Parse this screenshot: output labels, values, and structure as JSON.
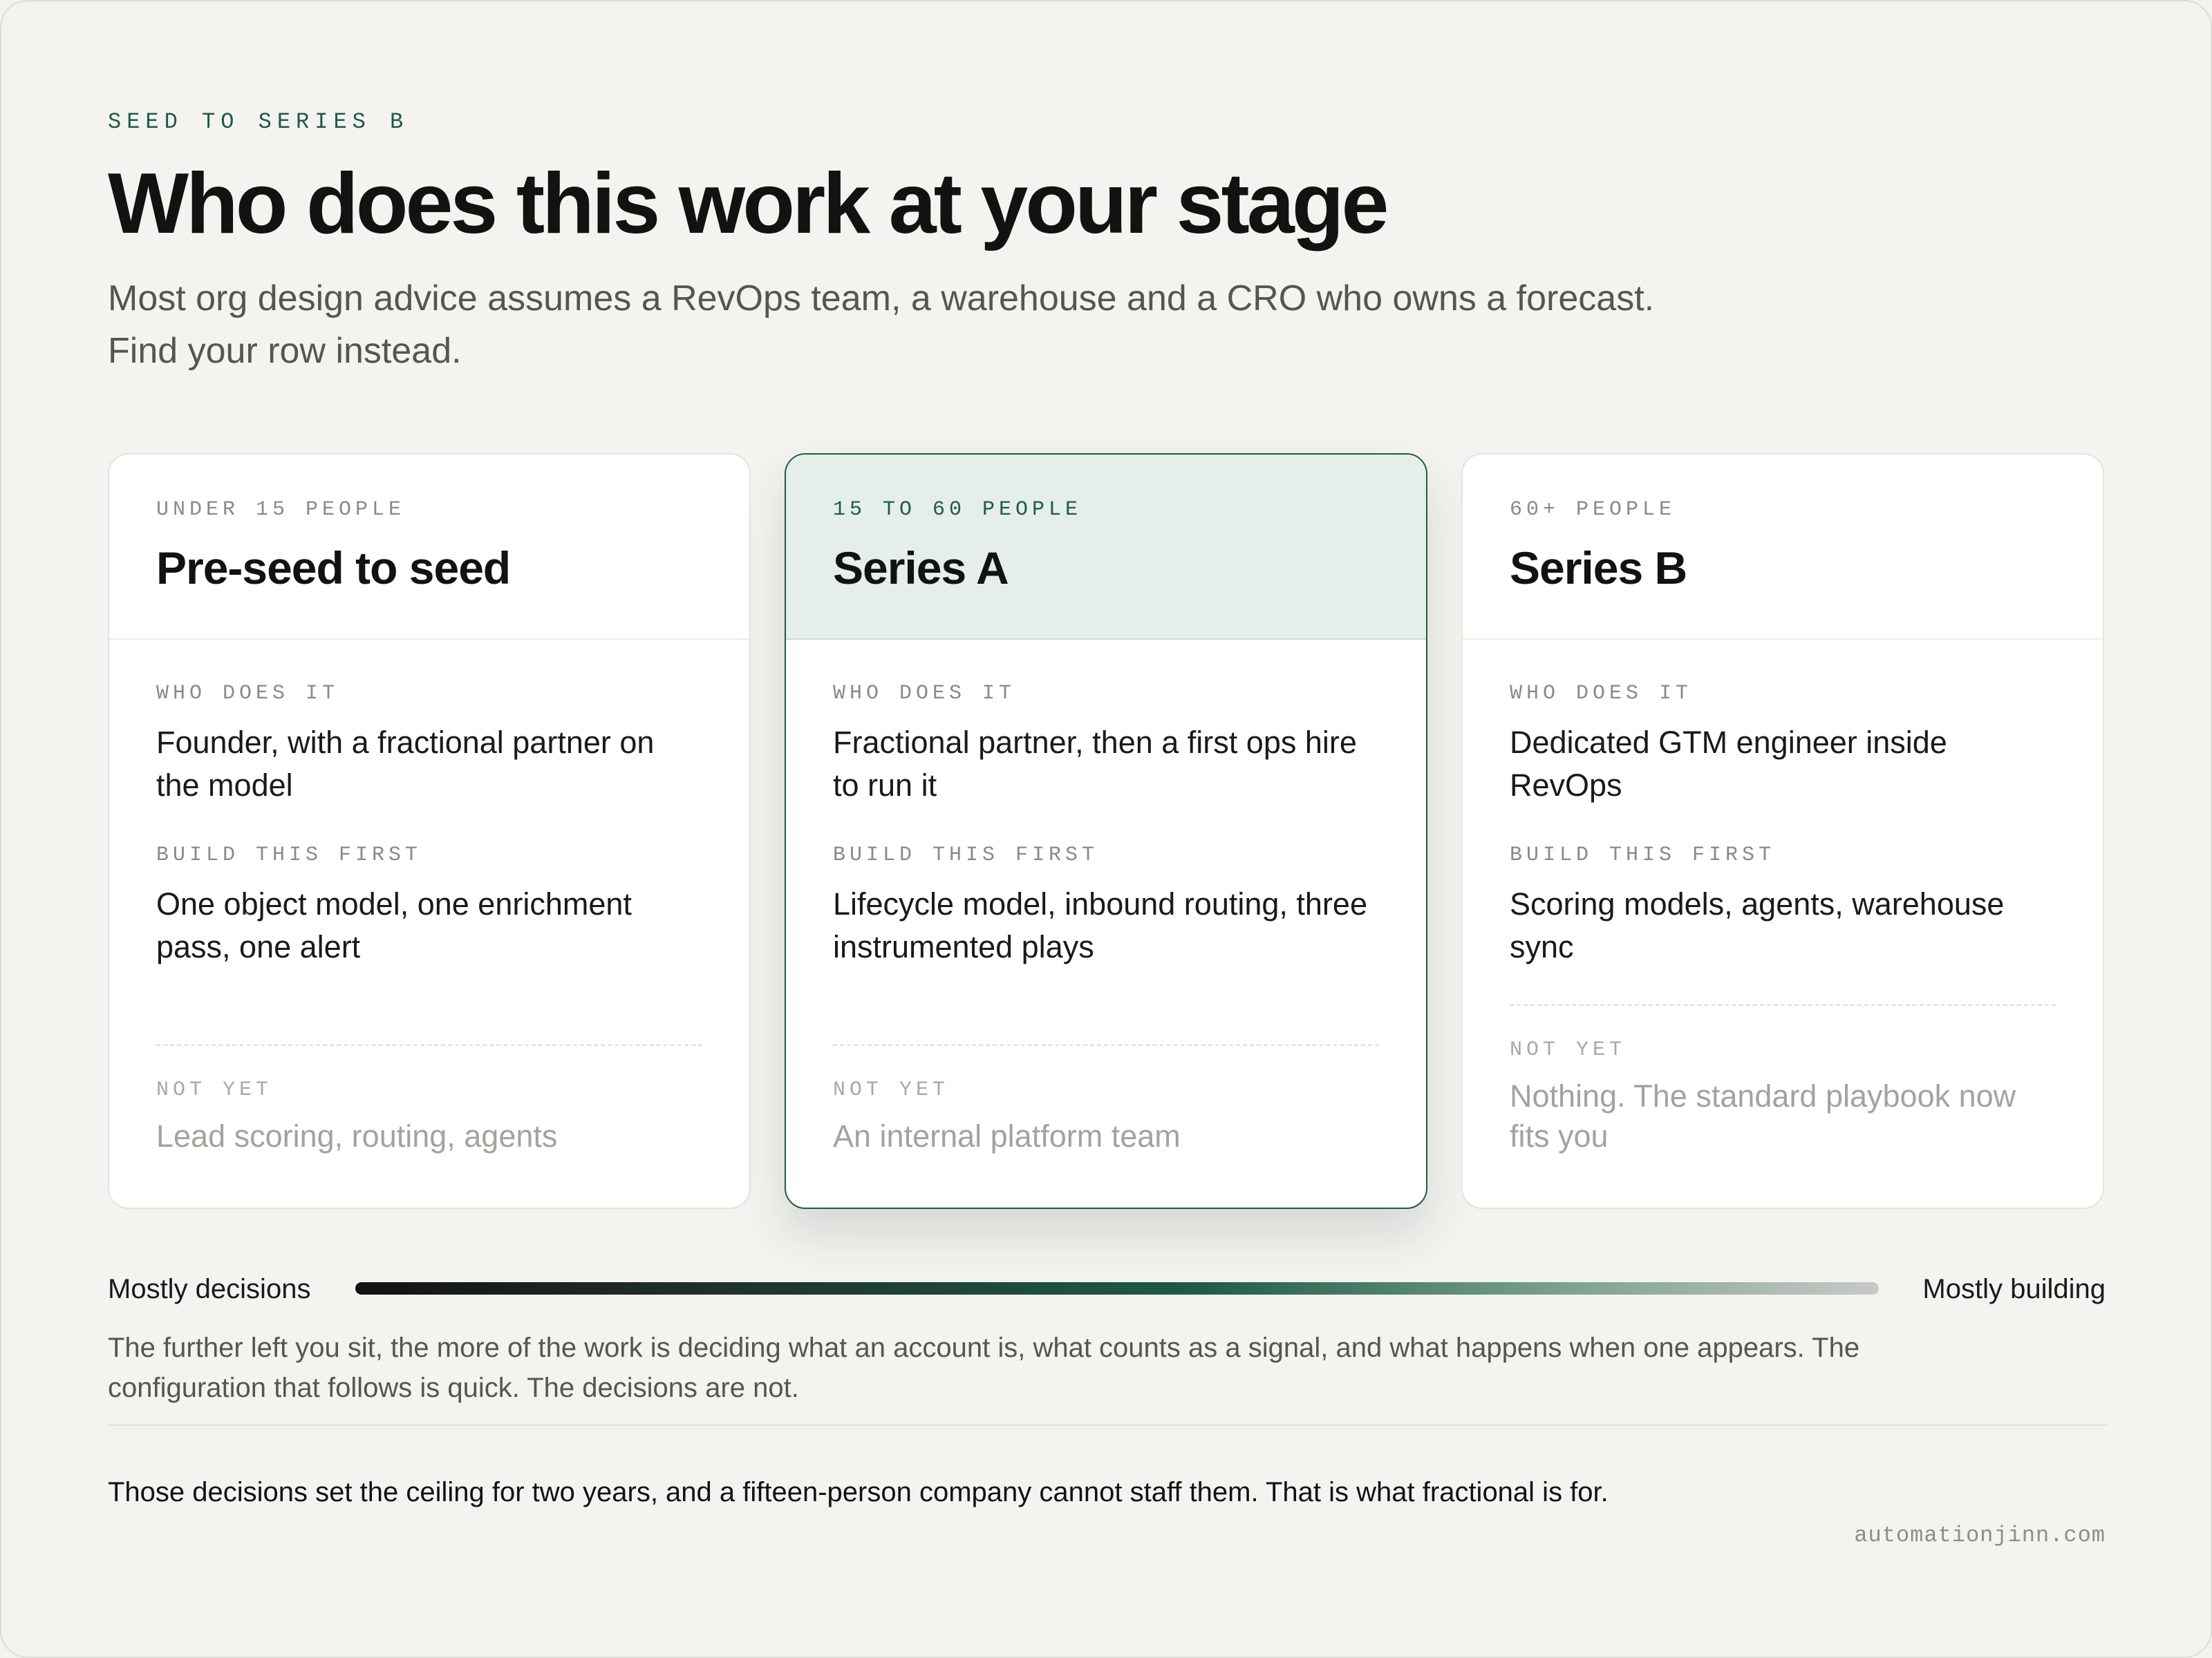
{
  "header": {
    "eyebrow": "SEED TO SERIES B",
    "title": "Who does this work at your stage",
    "subtitle_line1": "Most org design advice assumes a RevOps team, a warehouse and a CRO who owns a forecast.",
    "subtitle_line2": "Find your row instead."
  },
  "cards": [
    {
      "tag": "UNDER 15 PEOPLE",
      "title": "Pre-seed to seed",
      "who_label": "WHO DOES IT",
      "who_text": "Founder, with a fractional partner on the model",
      "build_label": "BUILD THIS FIRST",
      "build_text": "One object model, one enrichment pass, one alert",
      "notyet_label": "NOT YET",
      "notyet_text": "Lead scoring, routing, agents"
    },
    {
      "tag": "15 TO 60 PEOPLE",
      "title": "Series A",
      "who_label": "WHO DOES IT",
      "who_text": "Fractional partner, then a first ops hire to run it",
      "build_label": "BUILD THIS FIRST",
      "build_text": "Lifecycle model, inbound routing, three instrumented plays",
      "notyet_label": "NOT YET",
      "notyet_text": "An internal platform team"
    },
    {
      "tag": "60+ PEOPLE",
      "title": "Series B",
      "who_label": "WHO DOES IT",
      "who_text": "Dedicated GTM engineer inside RevOps",
      "build_label": "BUILD THIS FIRST",
      "build_text": "Scoring models, agents, warehouse sync",
      "notyet_label": "NOT YET",
      "notyet_text": "Nothing. The standard playbook now fits you"
    }
  ],
  "spectrum": {
    "left_label": "Mostly decisions",
    "right_label": "Mostly building"
  },
  "note": "The further left you sit, the more of the work is deciding what an account is, what counts as a signal, and what happens when one appears. The configuration that follows is quick. The decisions are not.",
  "closing": "Those decisions set the ceiling for two years, and a fifteen-person company cannot staff them. That is what fractional is for.",
  "site": "automationjinn.com",
  "colors": {
    "accent": "#1e5b44",
    "background": "#f4f3ef",
    "featured_header": "#e5eee8"
  }
}
